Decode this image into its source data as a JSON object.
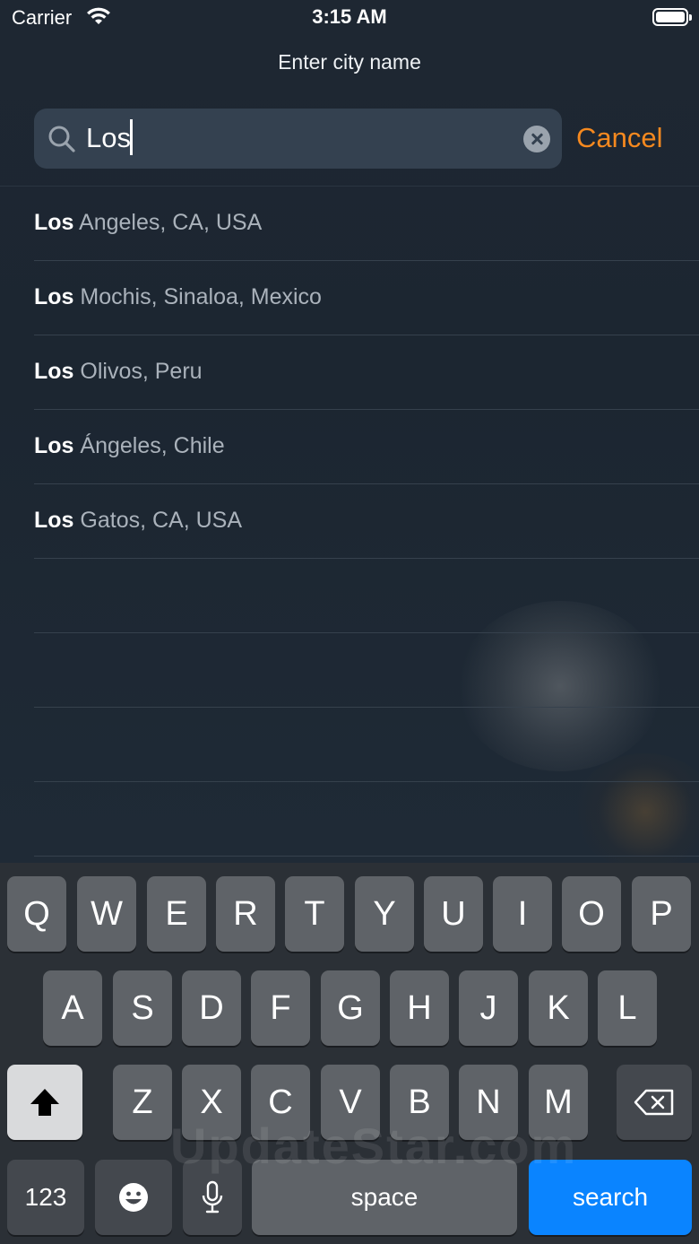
{
  "status_bar": {
    "carrier": "Carrier",
    "time": "3:15 AM"
  },
  "header": {
    "title": "Enter city name"
  },
  "search": {
    "value": "Los",
    "cancel_label": "Cancel"
  },
  "results": [
    {
      "match": "Los",
      "rest": " Angeles, CA, USA"
    },
    {
      "match": "Los",
      "rest": " Mochis, Sinaloa, Mexico"
    },
    {
      "match": "Los",
      "rest": " Olivos, Peru"
    },
    {
      "match": "Los",
      "rest": " Ángeles, Chile"
    },
    {
      "match": "Los",
      "rest": " Gatos, CA, USA"
    }
  ],
  "keyboard": {
    "row1": [
      "Q",
      "W",
      "E",
      "R",
      "T",
      "Y",
      "U",
      "I",
      "O",
      "P"
    ],
    "row2": [
      "A",
      "S",
      "D",
      "F",
      "G",
      "H",
      "J",
      "K",
      "L"
    ],
    "row3": [
      "Z",
      "X",
      "C",
      "V",
      "B",
      "N",
      "M"
    ],
    "numbers_label": "123",
    "space_label": "space",
    "search_label": "search"
  },
  "watermark": "UpdateStar.com",
  "colors": {
    "accent": "#f5891f",
    "search_key": "#0a84ff"
  }
}
